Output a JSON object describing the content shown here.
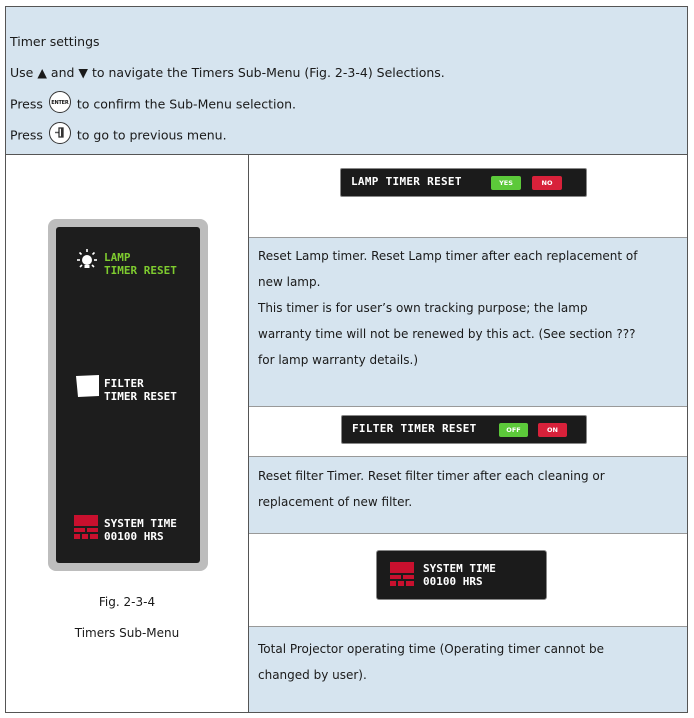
{
  "header": {
    "title": "Timer settings",
    "line1_prefix": "Use ▲ and ▼ to navigate the Timers Sub-Menu (Fig. 2-3-4) Selections.",
    "line2_prefix": "Press",
    "line2_suffix": "to confirm the Sub-Menu selection.",
    "line3_prefix": "Press",
    "line3_suffix": "to go to previous menu.",
    "enter_key": "ENTER"
  },
  "menu_panel": {
    "lamp_label_1": "LAMP",
    "lamp_label_2": "TIMER RESET",
    "filter_label_1": "FILTER",
    "filter_label_2": "TIMER RESET",
    "system_label_1": "SYSTEM TIME",
    "system_label_2": "00100 HRS",
    "figure_label": "Fig. 2-3-4",
    "figure_caption": "Timers Sub-Menu"
  },
  "lamp_reset": {
    "osd_label": "LAMP TIMER RESET",
    "opt_yes": "YES",
    "opt_no": "NO",
    "desc_lines": [
      "Reset Lamp timer. Reset Lamp timer after each replacement of",
      "new lamp.",
      "This timer is for user’s own tracking purpose; the lamp",
      "warranty time will not be renewed by this act. (See section ???",
      "for lamp warranty details.)"
    ]
  },
  "filter_reset": {
    "osd_label": "FILTER TIMER RESET",
    "opt_off": "OFF",
    "opt_on": "ON",
    "desc_lines": [
      "Reset filter Timer. Reset filter timer after each cleaning or",
      "replacement of new filter."
    ]
  },
  "system_time": {
    "osd_label_1": "SYSTEM TIME",
    "osd_label_2": "00100 HRS",
    "desc_lines": [
      "Total Projector operating time (Operating timer cannot be",
      "changed by user)."
    ]
  },
  "colors": {
    "header_bg": "#d6e4ef",
    "osd_bg": "#1b1b1b",
    "accent_green": "#7ecb2f",
    "option_green": "#5cc93a",
    "option_red": "#d8213a",
    "icon_red": "#c8102e"
  }
}
